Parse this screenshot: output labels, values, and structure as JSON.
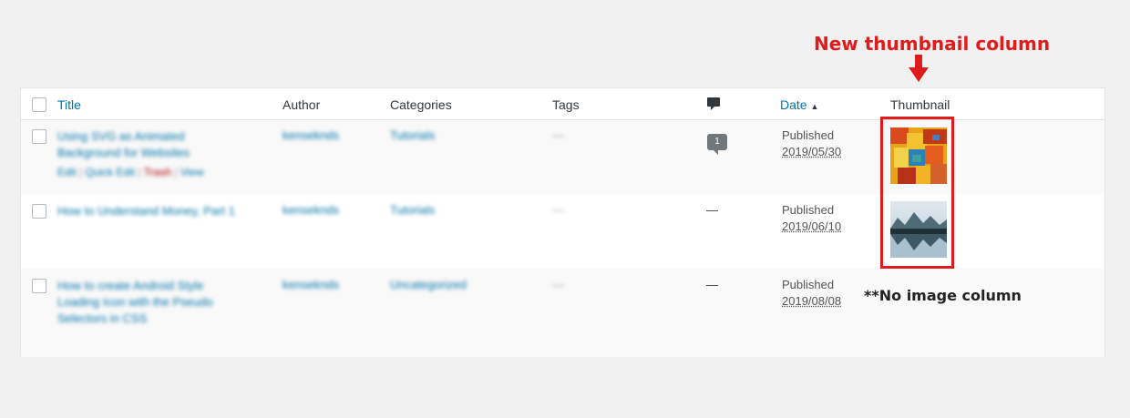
{
  "annotation": {
    "title": "New thumbnail column",
    "no_image_note": "**No image column",
    "accent_color": "#e01b1b"
  },
  "table": {
    "columns": {
      "title": "Title",
      "author": "Author",
      "categories": "Categories",
      "tags": "Tags",
      "comments_icon": "comment-icon",
      "date": "Date",
      "date_sort_indicator": "▲",
      "thumbnail": "Thumbnail"
    },
    "rows": [
      {
        "title": "Using SVG as Animated Background for Websites",
        "actions": {
          "edit": "Edit",
          "quick_edit": "Quick Edit",
          "trash": "Trash",
          "view": "View",
          "separator": "|"
        },
        "author": "kenseknds",
        "categories": "Tutorials",
        "tags": "—",
        "comments": "1",
        "date_status": "Published",
        "date_value": "2019/05/30",
        "thumbnail": "abstract-painting"
      },
      {
        "title": "How to Understand Money, Part 1",
        "author": "kenseknds",
        "categories": "Tutorials",
        "tags": "—",
        "comments": "—",
        "date_status": "Published",
        "date_value": "2019/06/10",
        "thumbnail": "mountain-lake"
      },
      {
        "title": "How to create Android Style Loading Icon with the Pseudo Selectors in CSS",
        "author": "kenseknds",
        "categories": "Uncategorized",
        "tags": "—",
        "comments": "—",
        "date_status": "Published",
        "date_value": "2019/08/08",
        "thumbnail": ""
      }
    ]
  }
}
